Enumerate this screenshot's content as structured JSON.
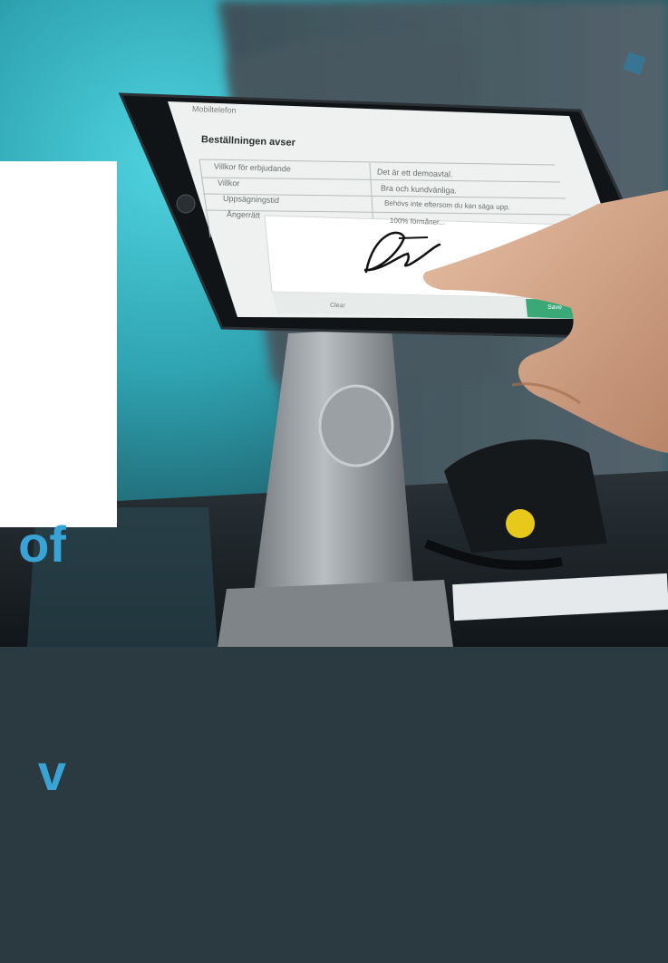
{
  "card": {
    "text_lines": [
      "of",
      "v"
    ],
    "color": "#3aa3d6"
  },
  "tablet_form": {
    "top_label": "Mobiltelefon",
    "section_heading": "Beställningen avser",
    "rows": [
      {
        "left": "Villkor för erbjudande",
        "right": "Det är ett demoavtal."
      },
      {
        "left": "Villkor",
        "right": "Bra och kundvänliga."
      },
      {
        "left": "Uppsägningstid",
        "right": "Behövs inte eftersom du kan säga upp."
      },
      {
        "left": "Ångerrätt",
        "right": "100% förmåner..."
      }
    ],
    "signature_dialog": {
      "clear_label": "Clear",
      "save_label": "Save",
      "save_color": "#3aa877"
    }
  },
  "colors": {
    "background_teal": "#3fbfcf",
    "stand": "#8a8f93"
  }
}
